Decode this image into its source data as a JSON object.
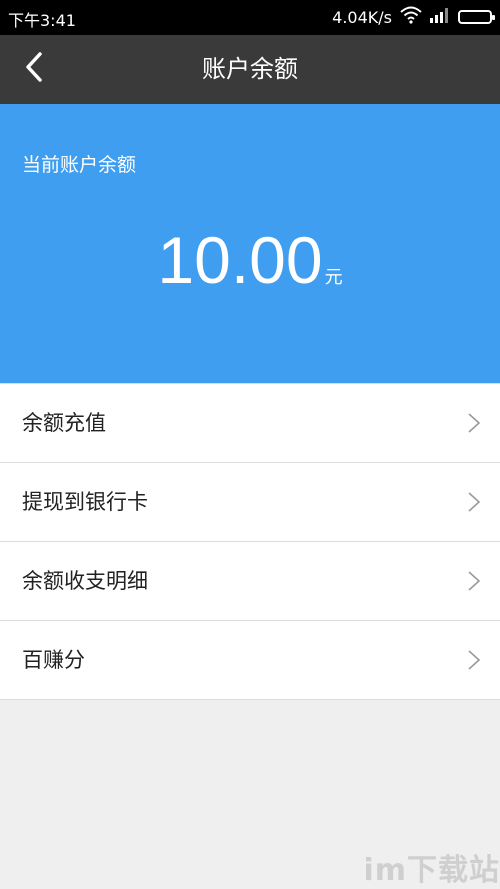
{
  "status_bar": {
    "time": "下午3:41",
    "network_speed": "4.04K/s",
    "icons": [
      "wifi-icon",
      "signal-icon",
      "battery-icon"
    ]
  },
  "app_bar": {
    "title": "账户余额",
    "back_icon": "back-chevron-icon"
  },
  "balance": {
    "label": "当前账户余额",
    "amount": "10.00",
    "unit": "元"
  },
  "menu": {
    "items": [
      {
        "label": "余额充值",
        "icon": "chevron-right-icon"
      },
      {
        "label": "提现到银行卡",
        "icon": "chevron-right-icon"
      },
      {
        "label": "余额收支明细",
        "icon": "chevron-right-icon"
      },
      {
        "label": "百赚分",
        "icon": "chevron-right-icon"
      }
    ]
  },
  "watermark": "im下载站",
  "colors": {
    "status_bar": "#000000",
    "app_bar": "#3a3a3a",
    "balance_panel": "#3f9ef0",
    "page_background": "#efefef"
  }
}
